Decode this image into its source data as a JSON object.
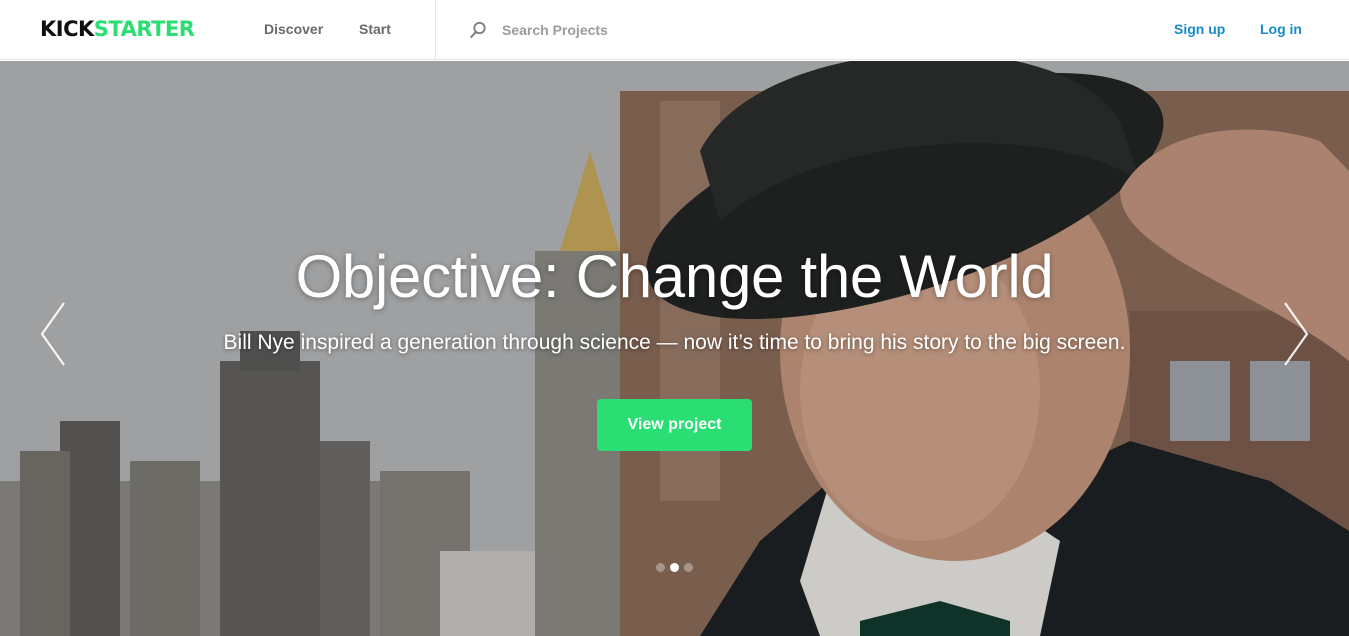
{
  "header": {
    "logo": {
      "part1": "KICK",
      "part2": "STARTER"
    },
    "nav": {
      "discover": "Discover",
      "start": "Start"
    },
    "search": {
      "placeholder": "Search Projects",
      "icon": "search-icon"
    },
    "auth": {
      "signup": "Sign up",
      "login": "Log in"
    }
  },
  "hero": {
    "title": "Objective: Change the World",
    "subtitle": "Bill Nye inspired a generation through science — now it’s time to bring his story to the big screen.",
    "cta_label": "View project",
    "carousel": {
      "total_slides": 3,
      "active_slide": 2
    }
  },
  "colors": {
    "brand_green": "#2bde73",
    "link_blue": "#188bc7",
    "nav_gray": "#6a6a6a"
  }
}
